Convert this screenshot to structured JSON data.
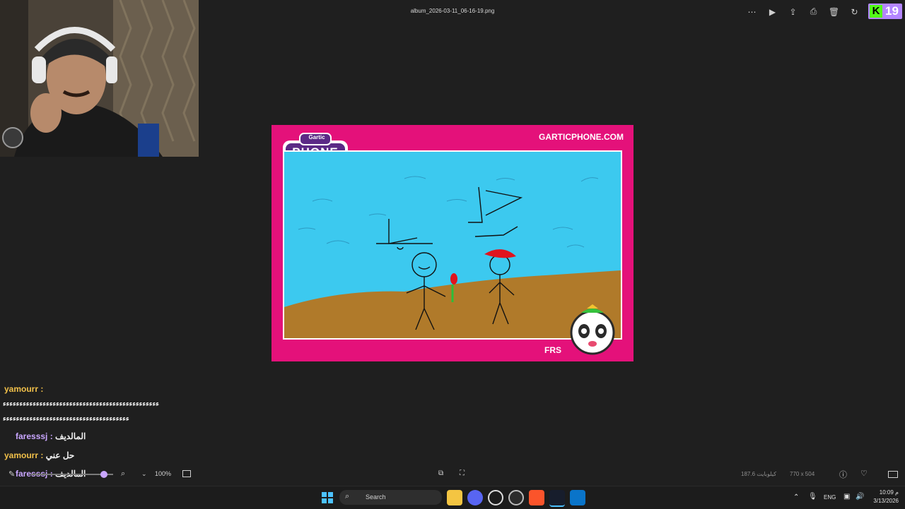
{
  "window": {
    "title": "album_2026-03-11_06-16-19.png"
  },
  "toolbar": {
    "icons": [
      "more-icon",
      "slideshow-icon",
      "share-icon",
      "print-icon",
      "delete-icon",
      "rotate-icon"
    ]
  },
  "kick_badge": {
    "logo": "K",
    "number": "19"
  },
  "image": {
    "site": "GARTICPHONE.COM",
    "logo_top": "Gartic",
    "logo_main": "PHONE",
    "player_tag": "FRS",
    "colors": {
      "frame": "#e4117a",
      "sky": "#3cc9ef",
      "ground": "#b07a2a"
    }
  },
  "chat": [
    {
      "user": "yamourr :",
      "message": ""
    },
    {
      "user": "",
      "message": "ءءءءءءءءءءءءءءءءءءءءءءءءءءءءءءءءءءءءءءءءءءءءءءء"
    },
    {
      "user": "",
      "message": "ءءءءءءءءءءءءءءءءءءءءءءءءءءءءءءءءءءءءءء"
    },
    {
      "user": "faresssj :",
      "message": "المالديف"
    },
    {
      "user": "yamourr :",
      "message": "حل عني"
    },
    {
      "user": "faresssj :",
      "message": "المالديف"
    }
  ],
  "viewer_bar": {
    "zoom": "100%",
    "file_size": "187.6 كيلوبايت",
    "dimensions": "770 x 504"
  },
  "taskbar": {
    "search_placeholder": "Search",
    "language": "ENG",
    "time": "10:09 م",
    "date": "3/13/2026"
  }
}
